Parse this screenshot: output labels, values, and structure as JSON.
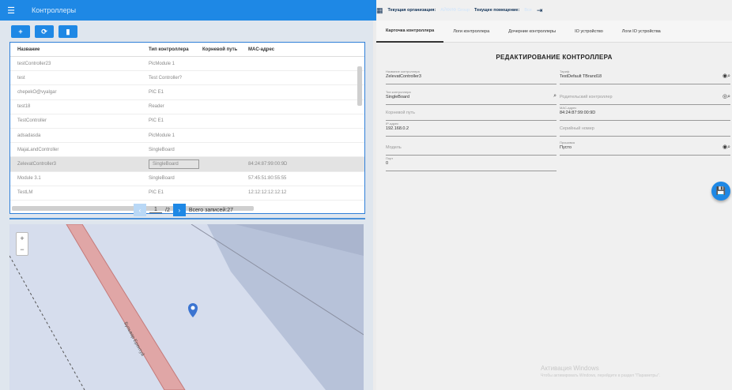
{
  "app": {
    "title": "Контроллеры",
    "org_label": "Текущая организация:",
    "org_value": "АЙФИФ Group",
    "room_label": "Текущее помещение:",
    "room_value": "Все"
  },
  "toolbar": {
    "add": "+",
    "refresh": "⟳",
    "delete": "▮"
  },
  "table": {
    "columns": [
      "Название",
      "Тип контроллера",
      "Корневой путь",
      "MAC-адрес"
    ],
    "rows": [
      [
        "testController23",
        "PicModule 1",
        "",
        ""
      ],
      [
        "test",
        "Test Controller?",
        "",
        ""
      ],
      [
        "chepekO@vyalgar",
        "PIC E1",
        "",
        ""
      ],
      [
        "test18",
        "Reader",
        "",
        ""
      ],
      [
        "TestController",
        "PIC E1",
        "",
        ""
      ],
      [
        "adsadasda",
        "PicModule 1",
        "",
        ""
      ],
      [
        "MajaLandController",
        "SingleBoard",
        "",
        ""
      ],
      [
        "ZelevatController3",
        "SingleBoard",
        "",
        "84:24:87:99:00:9D"
      ],
      [
        "Module 3.1",
        "SingleBoard",
        "",
        "57:45:51:80:55:55"
      ],
      [
        "TestLM",
        "PIC E1",
        "",
        "12:12:12:12:12:12"
      ]
    ]
  },
  "pager": {
    "page": "1",
    "total": "/2",
    "records": "Всего записей:27"
  },
  "tabs": [
    "Карточка контроллера",
    "Логи контроллера",
    "Дочерние контроллеры",
    "IO устройство",
    "Логи IO устройства"
  ],
  "form": {
    "title": "РЕДАКТИРОВАНИЕ КОНТРОЛЛЕРА",
    "name_label": "Название контроллера",
    "name": "ZelevatController3",
    "tariff_label": "Тариф",
    "tariff": "TestDefault TBrand18",
    "type_label": "Тип контроллера",
    "type": "SingleBoard",
    "parent_placeholder": "Родительский контроллер",
    "root_placeholder": "Корневой путь",
    "mac_label": "MAC-адрес",
    "mac": "84:24:87:99:00:9D",
    "ip_label": "IP-адрес",
    "ip": "192.168.0.2",
    "serial_placeholder": "Серийный номер",
    "model_placeholder": "Модель",
    "firmware_label": "Прошивка",
    "firmware": "Пусто",
    "port_label": "Порт",
    "port": "0"
  },
  "map": {
    "street_label": "Бульвар Ерентуй"
  },
  "watermark": {
    "line1": "Активация Windows",
    "line2": "Чтобы активировать Windows, перейдите в раздел \"Параметры\"."
  }
}
